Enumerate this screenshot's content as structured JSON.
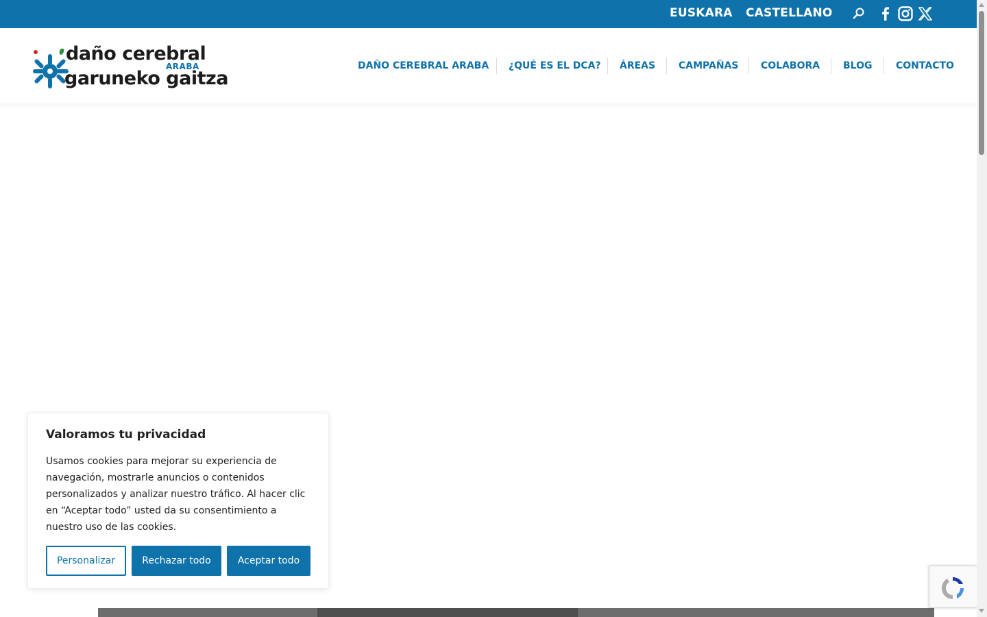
{
  "topbar": {
    "lang_eu": "EUSKARA",
    "lang_es": "CASTELLANO",
    "icons": [
      "search-icon",
      "facebook-icon",
      "instagram-icon",
      "x-icon"
    ]
  },
  "logo": {
    "line1": "daño cerebral",
    "sub": "ARABA",
    "line2": "garuneko gaitza"
  },
  "nav": {
    "items": [
      "DAÑO CEREBRAL ARABA",
      "¿QUÉ ES EL DCA?",
      "ÁREAS",
      "CAMPAÑAS",
      "COLABORA",
      "BLOG",
      "CONTACTO"
    ]
  },
  "cookie": {
    "title": "Valoramos tu privacidad",
    "text": "Usamos cookies para mejorar su experiencia de navegación, mostrarle anuncios o contenidos personalizados y analizar nuestro tráfico. Al hacer clic en “Aceptar todo” usted da su consentimiento a nuestro uso de las cookies.",
    "customize": "Personalizar",
    "reject": "Rechazar todo",
    "accept": "Aceptar todo"
  },
  "colors": {
    "brand_blue": "#1072ab",
    "logo_green": "#2f8f3f",
    "logo_red": "#cc2a2a"
  }
}
